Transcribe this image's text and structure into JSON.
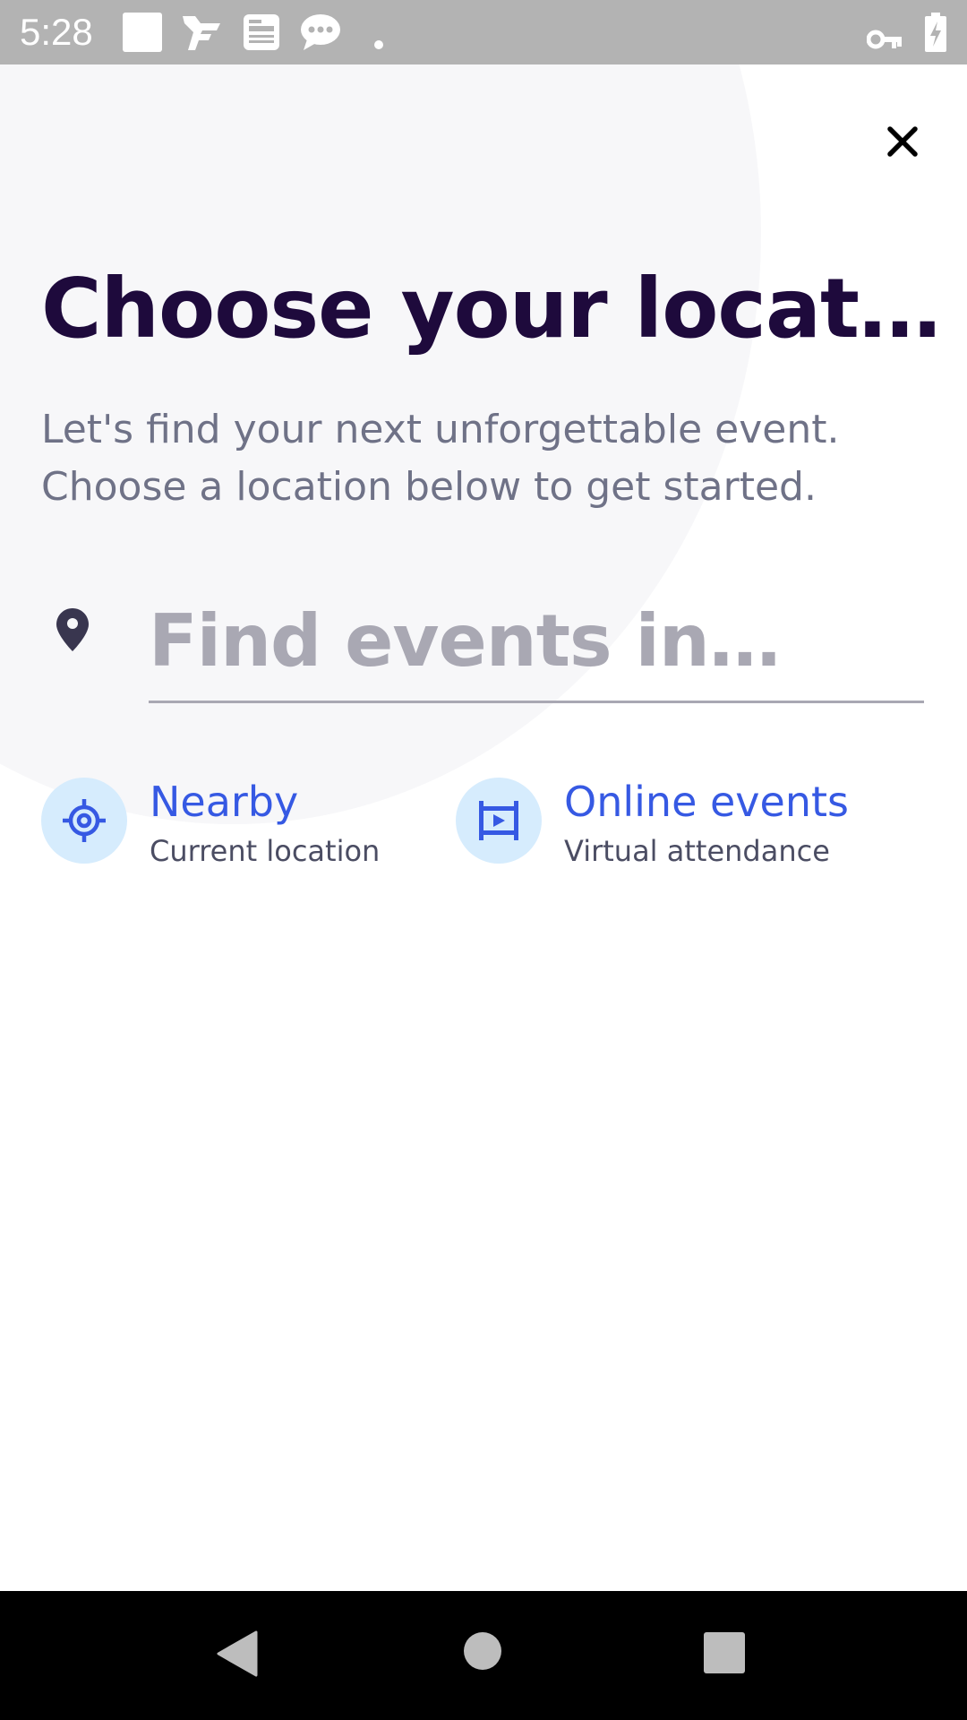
{
  "status_bar": {
    "time": "5:28",
    "icons": [
      "square-app-icon",
      "feedly-icon",
      "news-icon",
      "chat-icon",
      "dot-icon",
      "vpn-key-icon",
      "battery-charging-icon"
    ]
  },
  "header": {
    "close_icon": "close-icon"
  },
  "main": {
    "title": "Choose your locat…",
    "subtitle_lines": [
      "Let's find your next unforgettable event.",
      "Choose a location below to get started."
    ],
    "search": {
      "icon": "location-pin-icon",
      "placeholder": "Find events in…",
      "value": ""
    },
    "options": [
      {
        "label": "Nearby",
        "sublabel": "Current location",
        "icon": "crosshair-icon"
      },
      {
        "label": "Online events",
        "sublabel": "Virtual attendance",
        "icon": "video-frame-icon"
      }
    ]
  },
  "nav_bar": {
    "buttons": [
      "back-icon",
      "home-icon",
      "recents-icon"
    ]
  },
  "colors": {
    "title": "#1e0a3c",
    "subtitle": "#6f7287",
    "accent": "#3659e3",
    "icon_bg": "#d6ecfd",
    "placeholder": "#a9a8b3",
    "status_bar": "#b3b3b3"
  }
}
